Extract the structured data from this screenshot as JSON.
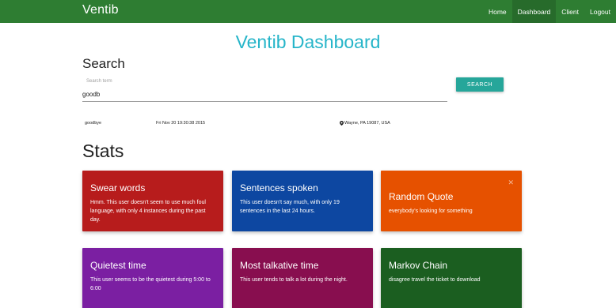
{
  "navbar": {
    "brand": "Ventib",
    "links": [
      "Home",
      "Dashboard",
      "Client",
      "Logout"
    ]
  },
  "page_title": "Ventib Dashboard",
  "search": {
    "heading": "Search",
    "label": "Search term",
    "value": "goodb",
    "button_label": "SEARCH"
  },
  "result": {
    "word": "goodbye",
    "time": "Fri Nov 20 19:30:38 2015",
    "location": "Wayne, PA 19087, USA",
    "icon": "map-pin-icon"
  },
  "stats": {
    "heading": "Stats",
    "cards": [
      {
        "title": "Swear words",
        "text": "Hmm. This user doesn't seem to use much foul language, with only 4 instances during the past day.",
        "color": "#b71c1c"
      },
      {
        "title": "Sentences spoken",
        "text": "This user doesn't say much, with only 19 sentences in the last 24 hours.",
        "color": "#0d47a1"
      },
      {
        "title": "Random Quote",
        "text": "everybody's looking for something",
        "color": "#e65100"
      },
      {
        "title": "Quietest time",
        "text": "This user seems to be the quietest during 5:00 to 6:00",
        "color": "#7b1fa2"
      },
      {
        "title": "Most talkative time",
        "text": "This user tends to talk a lot during the night.",
        "color": "#880e4f"
      },
      {
        "title": "Markov Chain",
        "text": "disagree travel the ticket to download",
        "color": "#1b5e20"
      }
    ]
  },
  "colors": {
    "navbar": "#2e7d32",
    "title": "#26b5c9",
    "button": "#26a69a"
  }
}
